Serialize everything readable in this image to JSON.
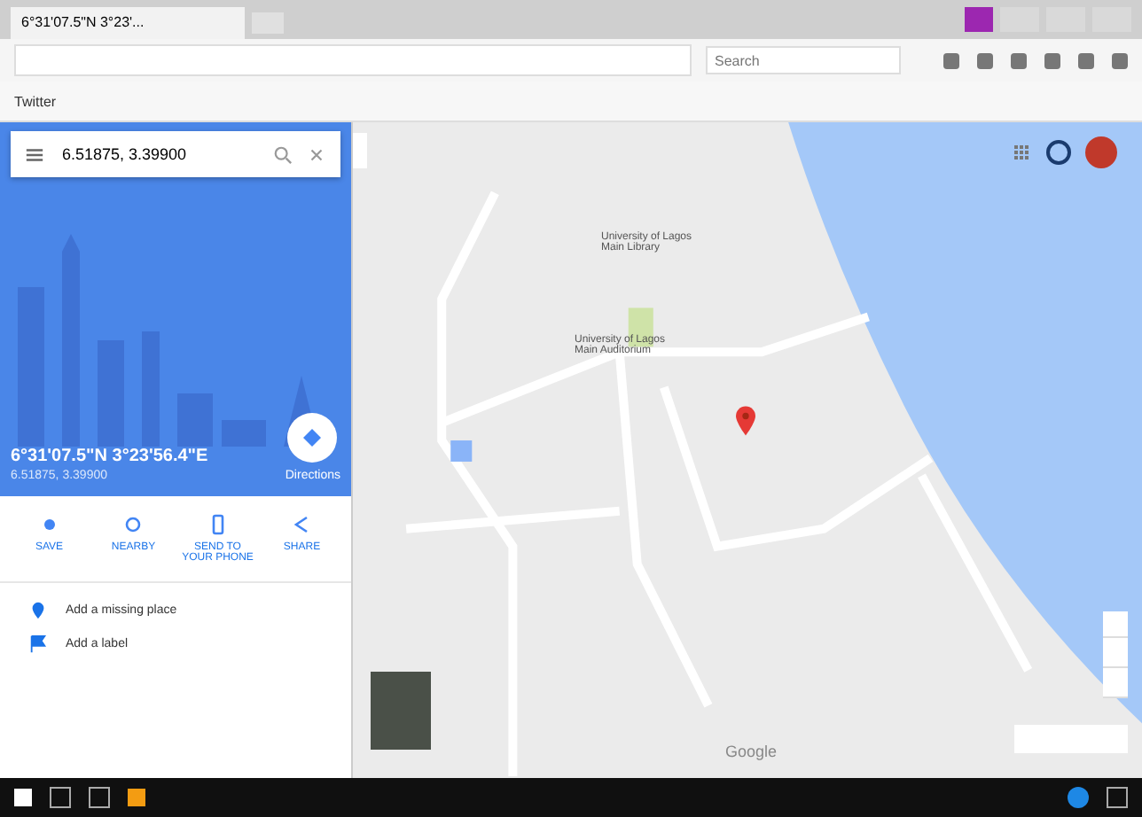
{
  "browser": {
    "tab_title": "6°31'07.5\"N 3°23'...",
    "search_placeholder": "Search",
    "bookmarks": [
      "Twitter"
    ]
  },
  "search": {
    "value": "6.51875, 3.39900"
  },
  "place": {
    "title": "6°31'07.5\"N 3°23'56.4\"E",
    "subtitle": "6.51875, 3.39900",
    "directions": "Directions"
  },
  "actions": [
    {
      "kind": "save",
      "label": "SAVE"
    },
    {
      "kind": "nearby",
      "label": "NEARBY"
    },
    {
      "kind": "phone",
      "label": "SEND TO YOUR PHONE"
    },
    {
      "kind": "share",
      "label": "SHARE"
    }
  ],
  "links": [
    {
      "kind": "place",
      "label": "Add a missing place"
    },
    {
      "kind": "label",
      "label": "Add a label"
    }
  ],
  "map": {
    "labels": [
      "University of Lagos Main Library",
      "University of Lagos Main Auditorium"
    ],
    "logo": "Google"
  }
}
